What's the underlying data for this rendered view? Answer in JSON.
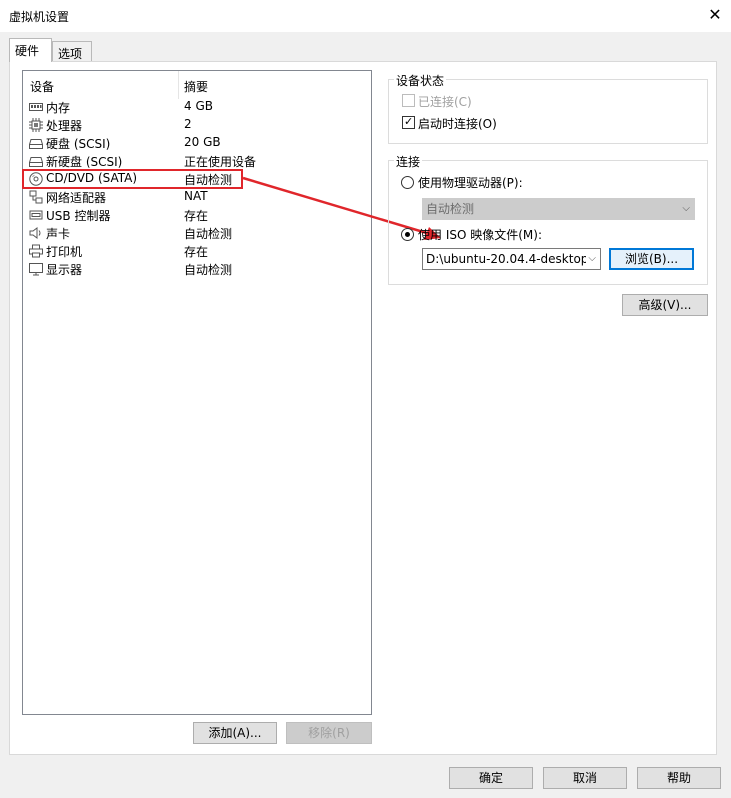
{
  "window": {
    "title": "虚拟机设置",
    "close_glyph": "✕"
  },
  "tabs": [
    {
      "label": "硬件",
      "active": true
    },
    {
      "label": "选项",
      "active": false
    }
  ],
  "device_list": {
    "headers": {
      "device": "设备",
      "summary": "摘要"
    },
    "rows": [
      {
        "name": "内存",
        "summary": "4 GB",
        "icon": "memory-icon"
      },
      {
        "name": "处理器",
        "summary": "2",
        "icon": "processor-icon"
      },
      {
        "name": "硬盘 (SCSI)",
        "summary": "20 GB",
        "icon": "hard-disk-icon"
      },
      {
        "name": "新硬盘 (SCSI)",
        "summary": "正在使用设备",
        "icon": "hard-disk-icon"
      },
      {
        "name": "CD/DVD (SATA)",
        "summary": "自动检测",
        "icon": "cd-dvd-icon"
      },
      {
        "name": "网络适配器",
        "summary": "NAT",
        "icon": "network-adapter-icon"
      },
      {
        "name": "USB 控制器",
        "summary": "存在",
        "icon": "usb-icon"
      },
      {
        "name": "声卡",
        "summary": "自动检测",
        "icon": "speaker-icon"
      },
      {
        "name": "打印机",
        "summary": "存在",
        "icon": "printer-icon"
      },
      {
        "name": "显示器",
        "summary": "自动检测",
        "icon": "monitor-icon"
      }
    ],
    "add_label": "添加(A)...",
    "remove_label": "移除(R)"
  },
  "device_status": {
    "group_label": "设备状态",
    "connected": {
      "label": "已连接(C)",
      "checked": false,
      "disabled": true
    },
    "connect_at_power_on": {
      "label": "启动时连接(O)",
      "checked": true
    }
  },
  "connection": {
    "group_label": "连接",
    "physical_drive": {
      "label": "使用物理驱动器(P):",
      "selected": false,
      "value": "自动检测"
    },
    "iso_image": {
      "label": "使用 ISO 映像文件(M):",
      "selected": true,
      "value": "D:\\ubuntu-20.04.4-desktop"
    },
    "browse_label": "浏览(B)..."
  },
  "advanced_label": "高级(V)...",
  "footer": {
    "ok": "确定",
    "cancel": "取消",
    "help": "帮助"
  },
  "annotation": {
    "color": "#e0262b"
  }
}
